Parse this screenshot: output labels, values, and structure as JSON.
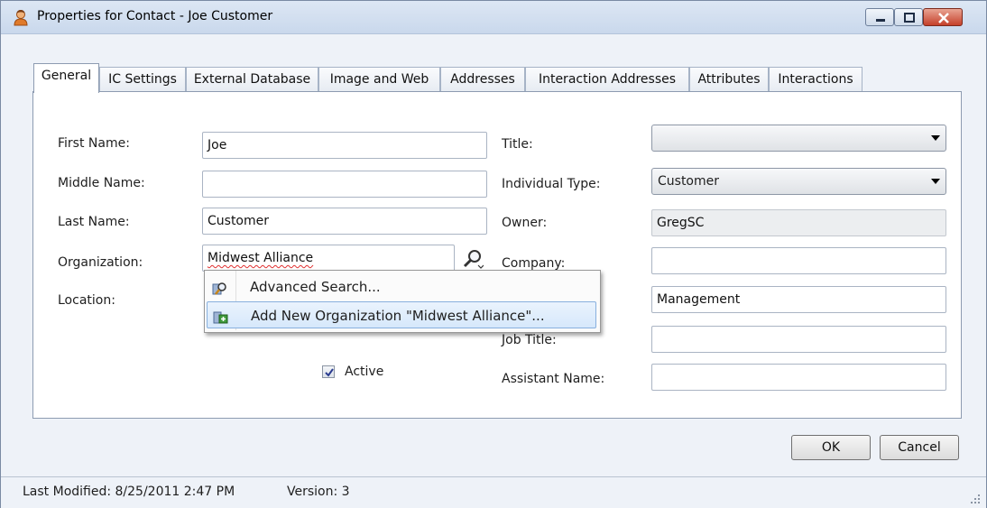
{
  "window": {
    "title": "Properties for Contact - Joe Customer",
    "icon": "contact-person-icon",
    "controls": [
      "minimize-icon",
      "maximize-icon",
      "close-icon"
    ]
  },
  "tabs": [
    {
      "label": "General",
      "active": true
    },
    {
      "label": "IC Settings"
    },
    {
      "label": "External Database"
    },
    {
      "label": "Image and Web"
    },
    {
      "label": "Addresses"
    },
    {
      "label": "Interaction Addresses"
    },
    {
      "label": "Attributes"
    },
    {
      "label": "Interactions"
    }
  ],
  "left_form": {
    "first_name_label": "First Name:",
    "first_name_value": "Joe",
    "middle_name_label": "Middle Name:",
    "middle_name_value": "",
    "last_name_label": "Last Name:",
    "last_name_value": "Customer",
    "organization_label": "Organization:",
    "organization_value": "Midwest Alliance",
    "location_label": "Location:",
    "active_label": "Active",
    "active_checked": true
  },
  "right_form": {
    "title_label": "Title:",
    "title_value": "",
    "individual_type_label": "Individual Type:",
    "individual_type_value": "Customer",
    "owner_label": "Owner:",
    "owner_value": "GregSC",
    "company_label": "Company:",
    "company_value": "",
    "department_value": "Management",
    "job_title_label": "Job Title:",
    "job_title_value": "",
    "assistant_name_label": "Assistant Name:",
    "assistant_name_value": ""
  },
  "popup": {
    "items": [
      {
        "label": "Advanced Search...",
        "icon": "advanced-search-icon"
      },
      {
        "label": "Add New Organization \"Midwest Alliance\"...",
        "icon": "add-organization-icon",
        "highlighted": true
      }
    ]
  },
  "buttons": {
    "ok": "OK",
    "cancel": "Cancel"
  },
  "status": {
    "last_modified": "Last Modified:  8/25/2011 2:47 PM",
    "version": "Version:  3"
  }
}
